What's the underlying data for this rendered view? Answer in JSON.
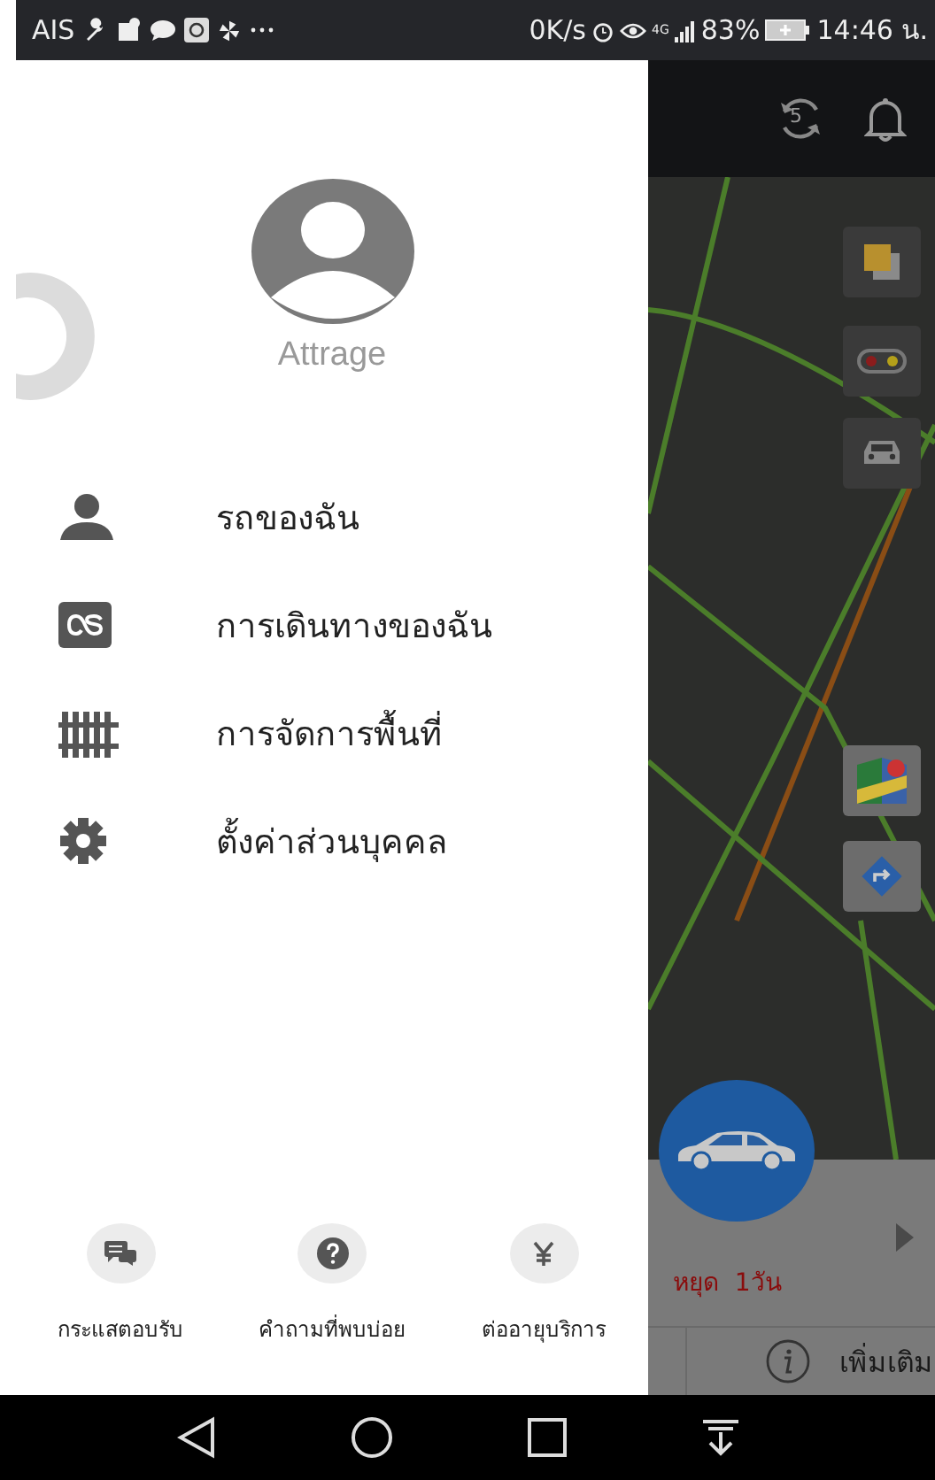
{
  "status_bar": {
    "carrier": "AIS",
    "speed": "0K/s",
    "network": "4G",
    "battery": "83%",
    "time": "14:46 น."
  },
  "map_header": {
    "refresh_count": "5"
  },
  "drawer": {
    "profile_name": "Attrage",
    "menu": [
      {
        "kind": "person",
        "label": "รถของฉัน"
      },
      {
        "kind": "trips",
        "label": "การเดินทางของฉัน"
      },
      {
        "kind": "fence",
        "label": "การจัดการพื้นที่"
      },
      {
        "kind": "gear",
        "label": "ตั้งค่าส่วนบุคคล"
      }
    ],
    "footer": [
      {
        "kind": "chat",
        "label": "กระแสตอบรับ"
      },
      {
        "kind": "help",
        "label": "คำถามที่พบบ่อย"
      },
      {
        "kind": "yen",
        "label": "ต่ออายุบริการ"
      }
    ]
  },
  "vehicle_panel": {
    "status": "หยุด  1วัน",
    "more": "เพิ่มเติม"
  }
}
